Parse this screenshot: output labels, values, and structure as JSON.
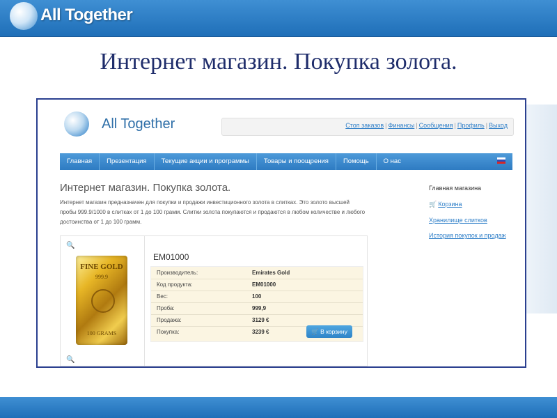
{
  "slide": {
    "brand": "All Together",
    "title": "Интернет магазин. Покупка золота."
  },
  "site": {
    "brand": "All Together",
    "user_nav": [
      "Стоп заказов",
      "Финансы",
      "Сообщения",
      "Профиль",
      "Выход"
    ],
    "main_nav": [
      "Главная",
      "Презентация",
      "Текущие акции и программы",
      "Товары и поощрения",
      "Помощь",
      "О нас"
    ],
    "page_title": "Интернет магазин. Покупка золота.",
    "description": "Интернет магазин предназначен для покупки и продажи инвестиционного золота в слитках. Это золото высшей пробы 999.9/1000 в слитках от 1 до 100 грамм. Слитки золота покупаются и продаются в любом количестве и любого достоинства от 1 до 100 грамм.",
    "sidebar": {
      "heading": "Главная магазина",
      "links": [
        "Корзина",
        "Хранилище слитков",
        "История покупок и продаж"
      ]
    },
    "product": {
      "code": "EM01000",
      "image_text": {
        "line1": "FINE GOLD",
        "line2": "999.9",
        "line3": "100 GRAMS"
      },
      "specs": [
        {
          "label": "Производитель:",
          "value": "Emirates Gold"
        },
        {
          "label": "Код продукта:",
          "value": "EM01000"
        },
        {
          "label": "Вес:",
          "value": "100"
        },
        {
          "label": "Проба:",
          "value": "999,9"
        },
        {
          "label": "Продажа:",
          "value": "3129 €"
        },
        {
          "label": "Покупка:",
          "value": "3239 €"
        }
      ],
      "cart_button": "В корзину"
    }
  },
  "icons": {
    "zoom": "magnifier-icon",
    "cart": "cart-icon",
    "flag": "russian-flag-icon",
    "globe": "globe-logo-icon"
  }
}
